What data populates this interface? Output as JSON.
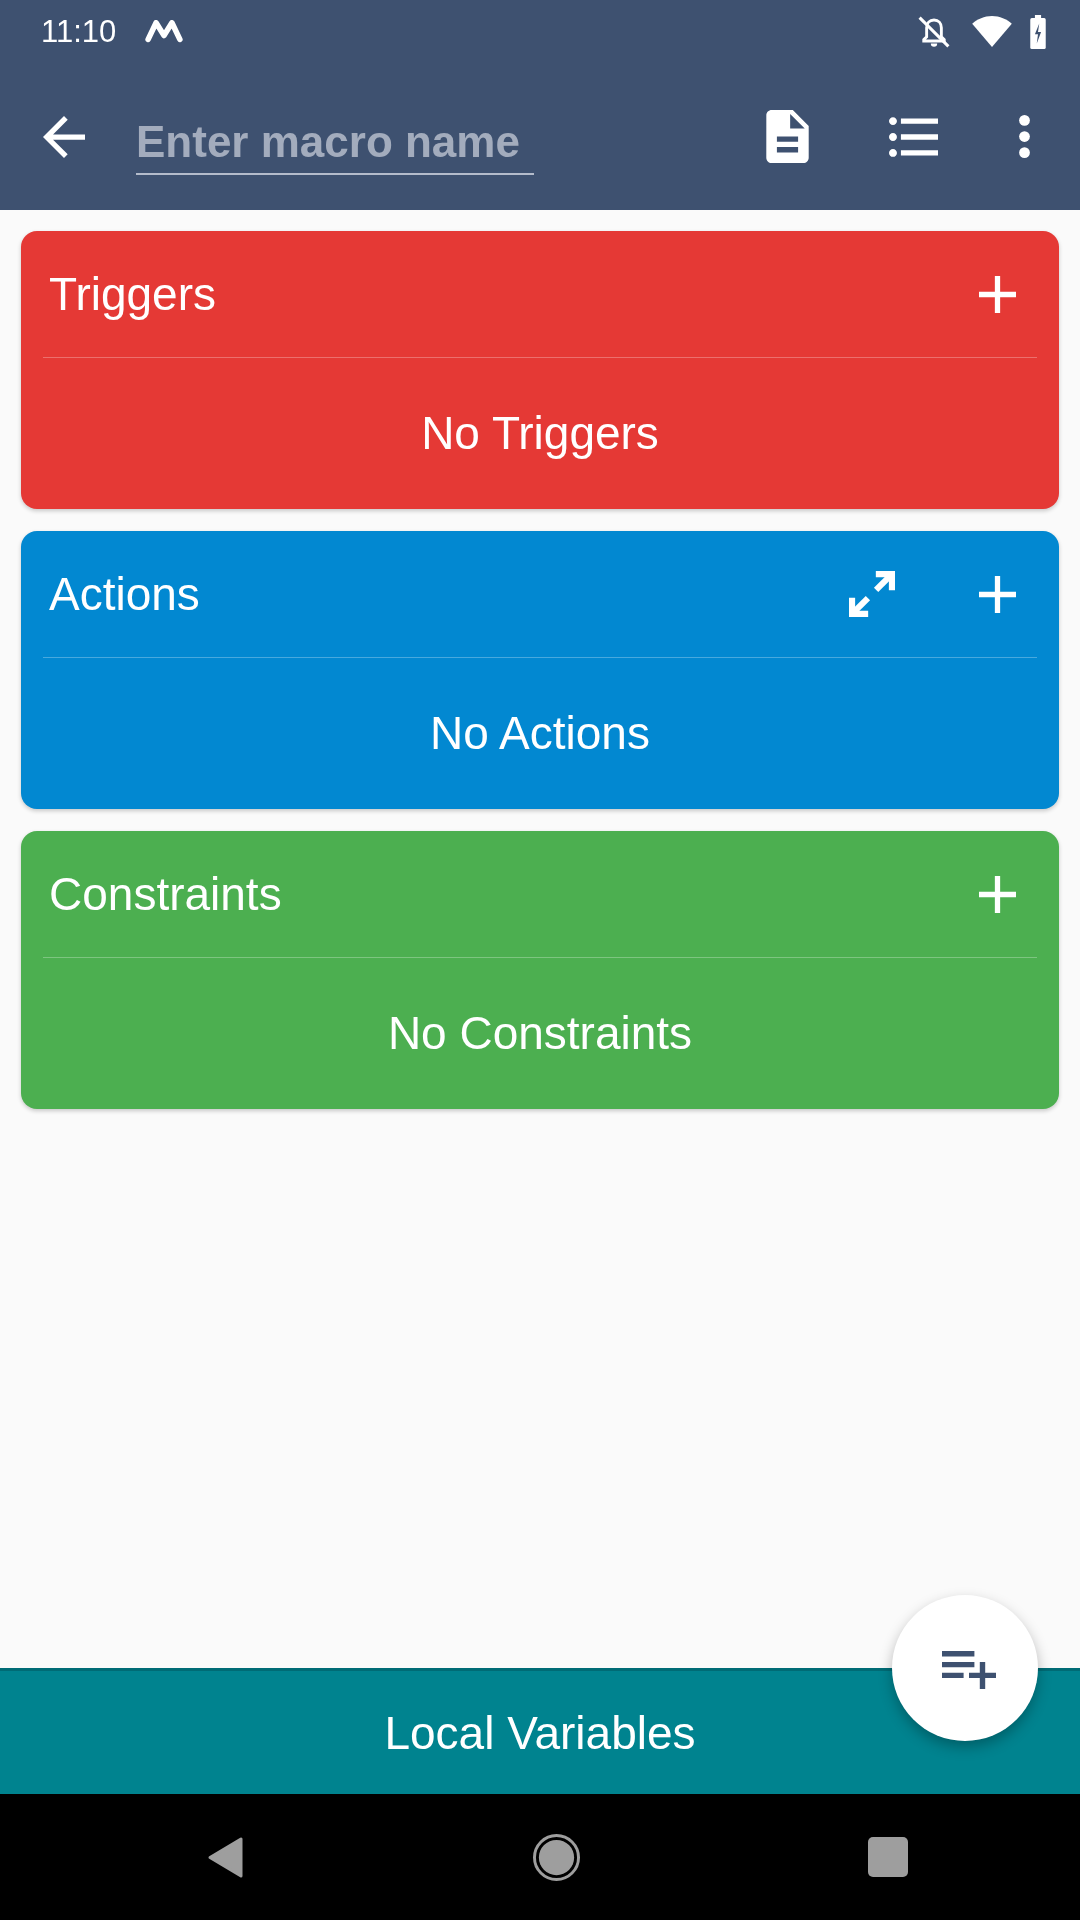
{
  "status_bar": {
    "time": "11:10"
  },
  "toolbar": {
    "name_field": {
      "placeholder": "Enter macro name"
    }
  },
  "sections": [
    {
      "title": "Triggers",
      "color": "#e53935",
      "empty_text": "No Triggers",
      "expand_button": false
    },
    {
      "title": "Actions",
      "color": "#0288d1",
      "empty_text": "No Actions",
      "expand_button": true
    },
    {
      "title": "Constraints",
      "color": "#4caf50",
      "empty_text": "No Constraints",
      "expand_button": false
    }
  ],
  "bottom_bar": {
    "label": "Local Variables"
  }
}
